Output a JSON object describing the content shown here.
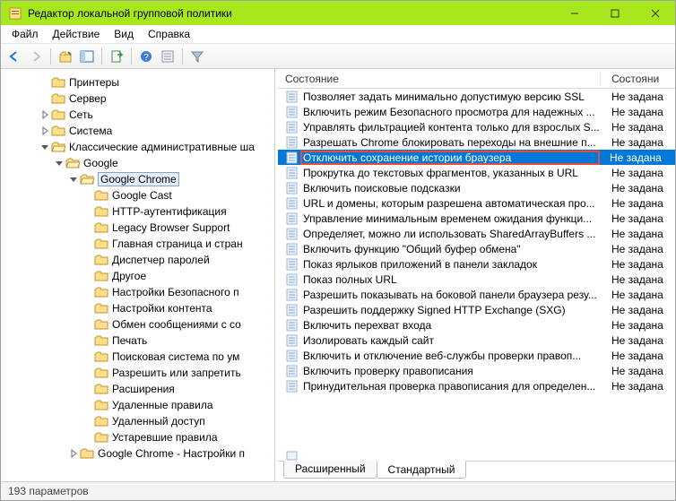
{
  "window": {
    "title": "Редактор локальной групповой политики"
  },
  "menu": {
    "file": "Файл",
    "action": "Действие",
    "view": "Вид",
    "help": "Справка"
  },
  "toolbar_icons": {
    "back": "back-arrow-icon",
    "forward": "forward-arrow-icon",
    "up": "up-folder-icon",
    "show_hide": "panel-toggle-icon",
    "export": "export-list-icon",
    "help": "help-icon",
    "props": "properties-icon",
    "filter": "filter-funnel-icon"
  },
  "tree": [
    {
      "label": "Принтеры",
      "depth": 1,
      "twisty": "none"
    },
    {
      "label": "Сервер",
      "depth": 1,
      "twisty": "none"
    },
    {
      "label": "Сеть",
      "depth": 1,
      "twisty": "closed"
    },
    {
      "label": "Система",
      "depth": 1,
      "twisty": "closed"
    },
    {
      "label": "Классические административные ша",
      "depth": 1,
      "twisty": "open"
    },
    {
      "label": "Google",
      "depth": 2,
      "twisty": "open"
    },
    {
      "label": "Google Chrome",
      "depth": 3,
      "twisty": "open",
      "selected": true
    },
    {
      "label": "Google Cast",
      "depth": 4,
      "twisty": "none"
    },
    {
      "label": "HTTP-аутентификация",
      "depth": 4,
      "twisty": "none"
    },
    {
      "label": "Legacy Browser Support",
      "depth": 4,
      "twisty": "none"
    },
    {
      "label": "Главная страница и стран",
      "depth": 4,
      "twisty": "none"
    },
    {
      "label": "Диспетчер паролей",
      "depth": 4,
      "twisty": "none"
    },
    {
      "label": "Другое",
      "depth": 4,
      "twisty": "none"
    },
    {
      "label": "Настройки Безопасного п",
      "depth": 4,
      "twisty": "none"
    },
    {
      "label": "Настройки контента",
      "depth": 4,
      "twisty": "none"
    },
    {
      "label": "Обмен сообщениями с со",
      "depth": 4,
      "twisty": "none"
    },
    {
      "label": "Печать",
      "depth": 4,
      "twisty": "none"
    },
    {
      "label": "Поисковая система по ум",
      "depth": 4,
      "twisty": "none"
    },
    {
      "label": "Разрешить или запретить",
      "depth": 4,
      "twisty": "none"
    },
    {
      "label": "Расширения",
      "depth": 4,
      "twisty": "none"
    },
    {
      "label": "Удаленные правила",
      "depth": 4,
      "twisty": "none"
    },
    {
      "label": "Удаленный доступ",
      "depth": 4,
      "twisty": "none"
    },
    {
      "label": "Устаревшие правила",
      "depth": 4,
      "twisty": "none"
    },
    {
      "label": "Google Chrome - Настройки п",
      "depth": 3,
      "twisty": "closed"
    }
  ],
  "list_header": {
    "col1": "Состояние",
    "col2": "Состояни"
  },
  "list": [
    {
      "name": "Позволяет задать минимально допустимую версию SSL",
      "state": "Не задана"
    },
    {
      "name": "Включить режим Безопасного просмотра для надежных ...",
      "state": "Не задана"
    },
    {
      "name": "Управлять фильтрацией контента только для взрослых S...",
      "state": "Не задана"
    },
    {
      "name": "Разрешать Chrome блокировать переходы на внешние п...",
      "state": "Не задана"
    },
    {
      "name": "Отключить сохранение истории браузера",
      "state": "Не задана",
      "selected": true
    },
    {
      "name": "Прокрутка до текстовых фрагментов, указанных в URL",
      "state": "Не задана"
    },
    {
      "name": "Включить поисковые подсказки",
      "state": "Не задана"
    },
    {
      "name": "URL и домены, которым разрешена автоматическая про...",
      "state": "Не задана"
    },
    {
      "name": "Управление минимальным временем ожидания функци...",
      "state": "Не задана"
    },
    {
      "name": "Определяет, можно ли использовать SharedArrayBuffers ...",
      "state": "Не задана"
    },
    {
      "name": "Включить функцию \"Общий буфер обмена\"",
      "state": "Не задана"
    },
    {
      "name": "Показ ярлыков приложений в панели закладок",
      "state": "Не задана"
    },
    {
      "name": "Показ полных URL",
      "state": "Не задана"
    },
    {
      "name": "Разрешить показывать на боковой панели браузера резу...",
      "state": "Не задана"
    },
    {
      "name": "Разрешить поддержку Signed HTTP Exchange (SXG)",
      "state": "Не задана"
    },
    {
      "name": "Включить перехват входа",
      "state": "Не задана"
    },
    {
      "name": "Изолировать каждый сайт",
      "state": "Не задана"
    },
    {
      "name": "Включить и отключение веб-службы проверки правоп...",
      "state": "Не задана"
    },
    {
      "name": "Включить проверку правописания",
      "state": "Не задана"
    },
    {
      "name": "Принудительная проверка правописания для определен...",
      "state": "Не задана"
    }
  ],
  "tabs": {
    "extended": "Расширенный",
    "standard": "Стандартный"
  },
  "status": {
    "text": "193 параметров"
  }
}
